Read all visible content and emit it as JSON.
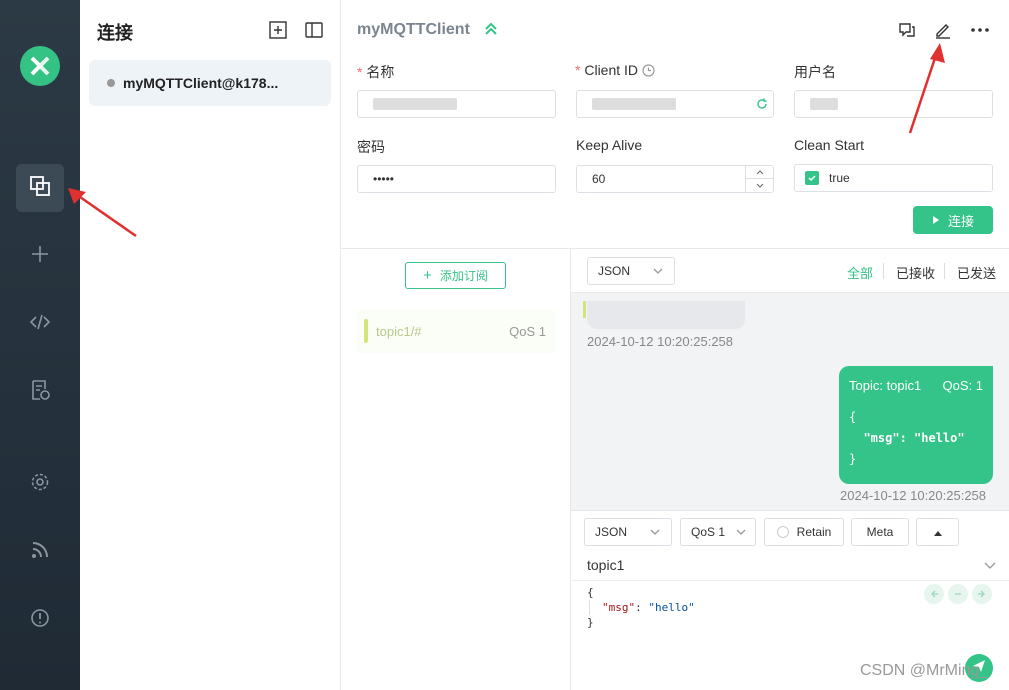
{
  "sidebar": {
    "items": [
      {
        "icon": "connections-icon",
        "active": true
      },
      {
        "icon": "plus-icon"
      },
      {
        "icon": "code-icon"
      },
      {
        "icon": "log-icon"
      },
      {
        "icon": "gear-icon"
      },
      {
        "icon": "rss-icon"
      },
      {
        "icon": "info-icon"
      }
    ]
  },
  "connections": {
    "title": "连接",
    "items": [
      {
        "name": "myMQTTClient@k178..."
      }
    ]
  },
  "header": {
    "name": "myMQTTClient"
  },
  "form": {
    "name_label": "名称",
    "client_id_label": "Client ID",
    "username_label": "用户名",
    "password_label": "密码",
    "password_value": "•••••",
    "keepalive_label": "Keep Alive",
    "keepalive_value": "60",
    "clean_start_label": "Clean Start",
    "clean_start_value": "true",
    "connect_label": "连接"
  },
  "subscriptions": {
    "add_label": "添加订阅",
    "items": [
      {
        "topic": "topic1/#",
        "qos": "QoS 1",
        "color": "#d4e47a"
      }
    ]
  },
  "messages": {
    "format": "JSON",
    "filters": [
      "全部",
      "已接收",
      "已发送"
    ],
    "items": [
      {
        "direction": "received",
        "time": "2024-10-12 10:20:25:258"
      },
      {
        "direction": "sent",
        "topic": "Topic: topic1",
        "qos": "QoS: 1",
        "payload_lines": [
          "{",
          "  \"msg\": \"hello\"",
          "}"
        ],
        "time": "2024-10-12 10:20:25:258"
      }
    ]
  },
  "publish": {
    "format": "JSON",
    "qos": "QoS 1",
    "retain_label": "Retain",
    "meta_label": "Meta",
    "topic": "topic1",
    "payload_lines": [
      "{",
      "\"msg\": \"hello\"",
      "}"
    ]
  },
  "watermark": "CSDN @MrMing_",
  "colors": {
    "accent": "#34c388",
    "nav_bg": "#26333e"
  }
}
